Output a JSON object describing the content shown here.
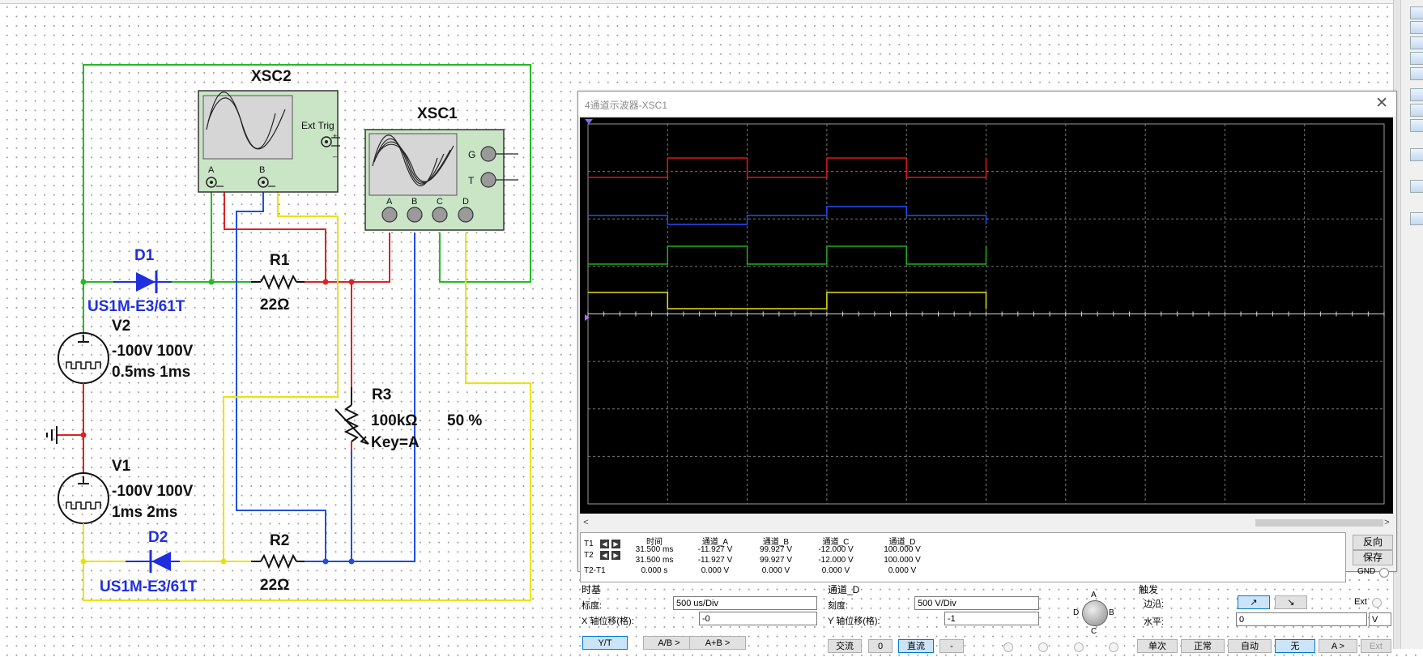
{
  "schematic": {
    "xsc2": {
      "name": "XSC2",
      "ext_trig": "Ext Trig",
      "pin_a": "A",
      "pin_b": "B",
      "plus": "+",
      "minus": "_"
    },
    "xsc1": {
      "name": "XSC1",
      "pin_g": "G",
      "pin_t": "T",
      "pin_a": "A",
      "pin_b": "B",
      "pin_c": "C",
      "pin_d": "D"
    },
    "d1": {
      "name": "D1",
      "model": "US1M-E3/61T"
    },
    "d2": {
      "name": "D2",
      "model": "US1M-E3/61T"
    },
    "r1": {
      "name": "R1",
      "value": "22Ω"
    },
    "r2": {
      "name": "R2",
      "value": "22Ω"
    },
    "r3": {
      "name": "R3",
      "value": "100kΩ",
      "percent": "50 %",
      "key": "Key=A"
    },
    "v2": {
      "name": "V2",
      "line1": "-100V 100V",
      "line2": "0.5ms 1ms"
    },
    "v1": {
      "name": "V1",
      "line1": "-100V 100V",
      "line2": "1ms 2ms"
    },
    "wire_colors": {
      "green": "#22bb22",
      "red": "#e02020",
      "blue": "#1f4fe0",
      "yellow": "#ece200",
      "component": "#111111",
      "diode": "#1f2fe0"
    }
  },
  "scope": {
    "title": "4通道示波器-XSC1",
    "close": "✕",
    "traces": {
      "colors": {
        "A": "#e01818",
        "B": "#2050ff",
        "C": "#20b020",
        "D": "#e6e010"
      },
      "time_ms": [
        0,
        0.5,
        1.0,
        1.5,
        2.0,
        2.5
      ],
      "A_steps": [
        -1,
        1,
        -1,
        1,
        -1,
        1
      ],
      "B_steps": [
        0,
        -1,
        0,
        1,
        0,
        -1
      ],
      "C_steps": [
        -1,
        1,
        -1,
        1,
        -1,
        1
      ],
      "D_steps": [
        1,
        -1,
        -1,
        1,
        1,
        -1
      ],
      "time_per_div_ms": 0.5,
      "visible_span_ms": 2.5
    },
    "readout": {
      "headers": [
        "时间",
        "通道_A",
        "通道_B",
        "通道_C",
        "通道_D"
      ],
      "rows": [
        {
          "label": "T1",
          "values": [
            "31.500 ms",
            "-11.927 V",
            "99.927 V",
            "-12.000 V",
            "100.000 V"
          ]
        },
        {
          "label": "T2",
          "values": [
            "31.500 ms",
            "-11.927 V",
            "99.927 V",
            "-12.000 V",
            "100.000 V"
          ]
        },
        {
          "label": "T2-T1",
          "values": [
            "0.000 s",
            "0.000 V",
            "0.000 V",
            "0.000 V",
            "0.000 V"
          ]
        }
      ],
      "reverse_btn": "反向",
      "save_btn": "保存",
      "gnd": "GND"
    },
    "timebase": {
      "title": "时基",
      "scale_label": "标度:",
      "scale_value": "500 us/Div",
      "xpos_label": "X 轴位移(格):",
      "xpos_value": "-0",
      "modes": [
        "Y/T",
        "A/B >",
        "A+B >"
      ]
    },
    "channel": {
      "title": "通道_D",
      "scale_label": "刻度:",
      "scale_value": "500  V/Div",
      "ypos_label": "Y 轴位移(格):",
      "ypos_value": "-1",
      "knob_labels": {
        "a": "A",
        "b": "B",
        "c": "C",
        "d": "D"
      },
      "coupling": [
        "交流",
        "0",
        "直流",
        "-"
      ]
    },
    "trigger": {
      "title": "触发",
      "edge_label": "边沿:",
      "edge_rise": "↗",
      "edge_fall": "↘",
      "ext_label": "Ext",
      "level_label": "水平:",
      "level_value": "0",
      "level_unit": "V",
      "modes": [
        "单次",
        "正常",
        "自动",
        "无",
        "A >",
        "Ext"
      ]
    }
  }
}
